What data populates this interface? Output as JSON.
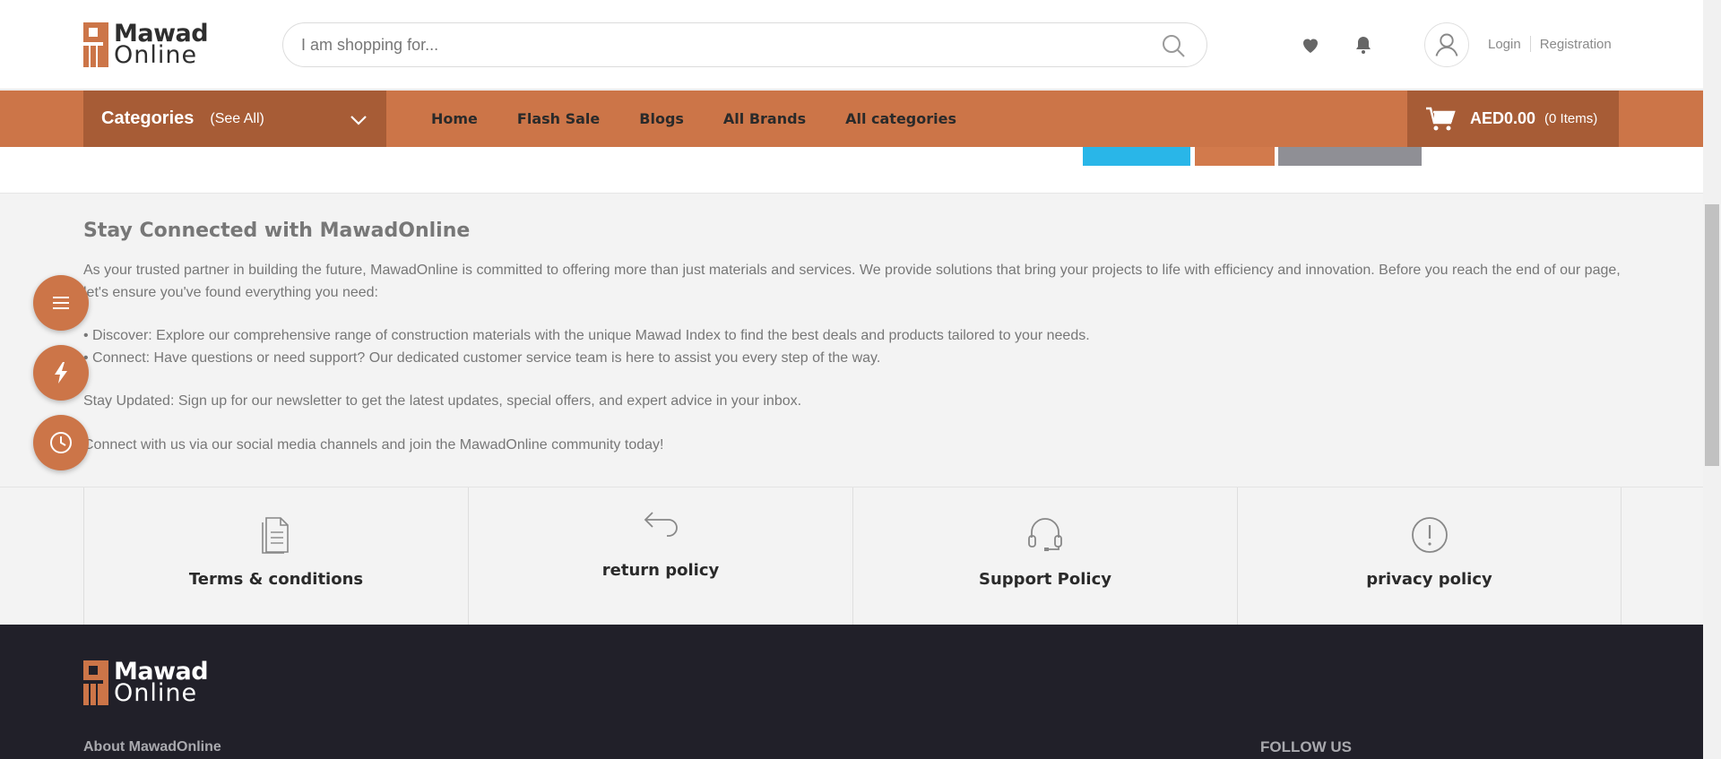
{
  "brand": {
    "line1": "Mawad",
    "line2": "Online",
    "accent": "#cc7548",
    "accent_dark": "#a75c36"
  },
  "header": {
    "search_placeholder": "I am shopping for...",
    "icons": [
      "search-icon",
      "heart-icon",
      "bell-icon",
      "user-icon"
    ],
    "login": "Login",
    "registration": "Registration"
  },
  "nav": {
    "categories_title": "Categories",
    "categories_see_all": "(See All)",
    "links": [
      "Home",
      "Flash Sale",
      "Blogs",
      "All Brands",
      "All categories"
    ],
    "cart_amount": "AED0.00",
    "cart_items": "(0 Items)"
  },
  "stay": {
    "title": "Stay Connected with MawadOnline",
    "intro": "As your trusted partner in building the future, MawadOnline is committed to offering more than just materials and services. We provide solutions that bring your projects to life with efficiency and innovation. Before you reach the end of our page, let's ensure you've found everything you need:",
    "discover": "• Discover: Explore our comprehensive range of construction materials with the unique Mawad Index to find the best deals and products tailored to your needs.",
    "connect": "• Connect: Have questions or need support? Our dedicated customer service team is here to assist you every step of the way.",
    "updated": "Stay Updated: Sign up for our newsletter to get the latest updates, special offers, and expert advice in your inbox.",
    "social": "Connect with us via our social media channels and join the MawadOnline community today!"
  },
  "policies": [
    {
      "label": "Terms & conditions",
      "icon": "document-icon"
    },
    {
      "label": "return policy",
      "icon": "return-arrow-icon"
    },
    {
      "label": "Support Policy",
      "icon": "headset-icon"
    },
    {
      "label": "privacy policy",
      "icon": "exclamation-icon"
    }
  ],
  "floating": [
    "menu-icon",
    "flash-icon",
    "clock-icon"
  ],
  "footer": {
    "about": "About MawadOnline",
    "follow": "FOLLOW US"
  }
}
